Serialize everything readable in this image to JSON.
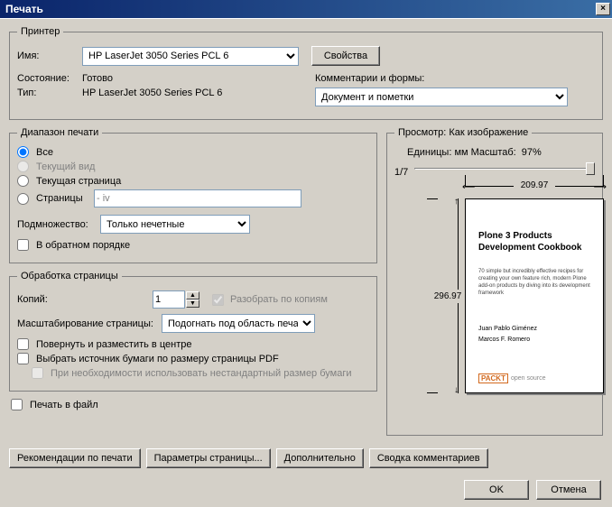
{
  "title": "Печать",
  "printer": {
    "legend": "Принтер",
    "name_label": "Имя:",
    "name_value": "HP LaserJet 3050 Series PCL 6",
    "properties_btn": "Свойства",
    "status_label": "Состояние:",
    "status_value": "Готово",
    "type_label": "Тип:",
    "type_value": "HP LaserJet 3050 Series PCL 6",
    "comments_label": "Комментарии и формы:",
    "comments_value": "Документ и пометки"
  },
  "range": {
    "legend": "Диапазон печати",
    "all": "Все",
    "current_view": "Текущий вид",
    "current_page": "Текущая страница",
    "pages": "Страницы",
    "pages_value": "- iv",
    "subset_label": "Подмножество:",
    "subset_value": "Только нечетные",
    "reverse": "В обратном порядке"
  },
  "handling": {
    "legend": "Обработка страницы",
    "copies_label": "Копий:",
    "copies_value": "1",
    "collate": "Разобрать по копиям",
    "scaling_label": "Масштабирование страницы:",
    "scaling_value": "Подогнать под область печат",
    "rotate_center": "Повернуть и разместить в центре",
    "paper_source": "Выбрать источник бумаги по размеру страницы PDF",
    "custom_paper": "При необходимости использовать нестандартный размер бумаги"
  },
  "print_to_file": "Печать в файл",
  "preview": {
    "legend": "Просмотр: Как изображение",
    "units_label": "Единицы: мм Масштаб:",
    "zoom": "97%",
    "page_indicator": "1/7",
    "width": "209.97",
    "height": "296.97",
    "doc_title1": "Plone 3 Products",
    "doc_title2": "Development Cookbook",
    "doc_sub": "70 simple but incredibly effective recipes for creating your own feature rich, modern Plone add-on products by diving into its development framework",
    "author1": "Juan Pablo Giménez",
    "author2": "Marcos F. Romero",
    "packt": "PACKT",
    "open_source": "open source"
  },
  "buttons": {
    "tips": "Рекомендации по печати",
    "page_setup": "Параметры страницы...",
    "advanced": "Дополнительно",
    "comments_summary": "Сводка комментариев",
    "ok": "OK",
    "cancel": "Отмена"
  }
}
